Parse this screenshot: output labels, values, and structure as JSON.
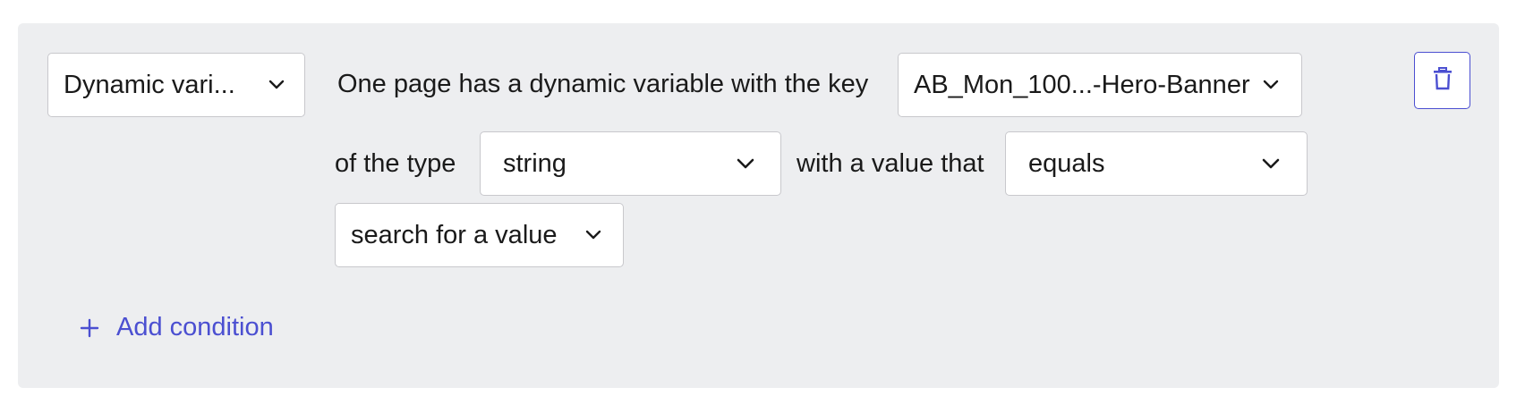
{
  "condition": {
    "type_select": {
      "value": "Dynamic vari..."
    },
    "text_lead": "One page has a dynamic variable with the key",
    "key_select": {
      "value": "AB_Mon_100...-Hero-Banner"
    },
    "text_of_type": "of the type",
    "datatype_select": {
      "value": "string"
    },
    "text_value_that": "with a value that",
    "operator_select": {
      "value": "equals"
    },
    "value_select": {
      "value": "search for a value"
    }
  },
  "actions": {
    "add_condition_label": "Add condition",
    "delete_icon": "trash-icon"
  },
  "colors": {
    "accent": "#4b4fd1",
    "panel_bg": "#edeef0",
    "border": "#c8c8cc"
  }
}
